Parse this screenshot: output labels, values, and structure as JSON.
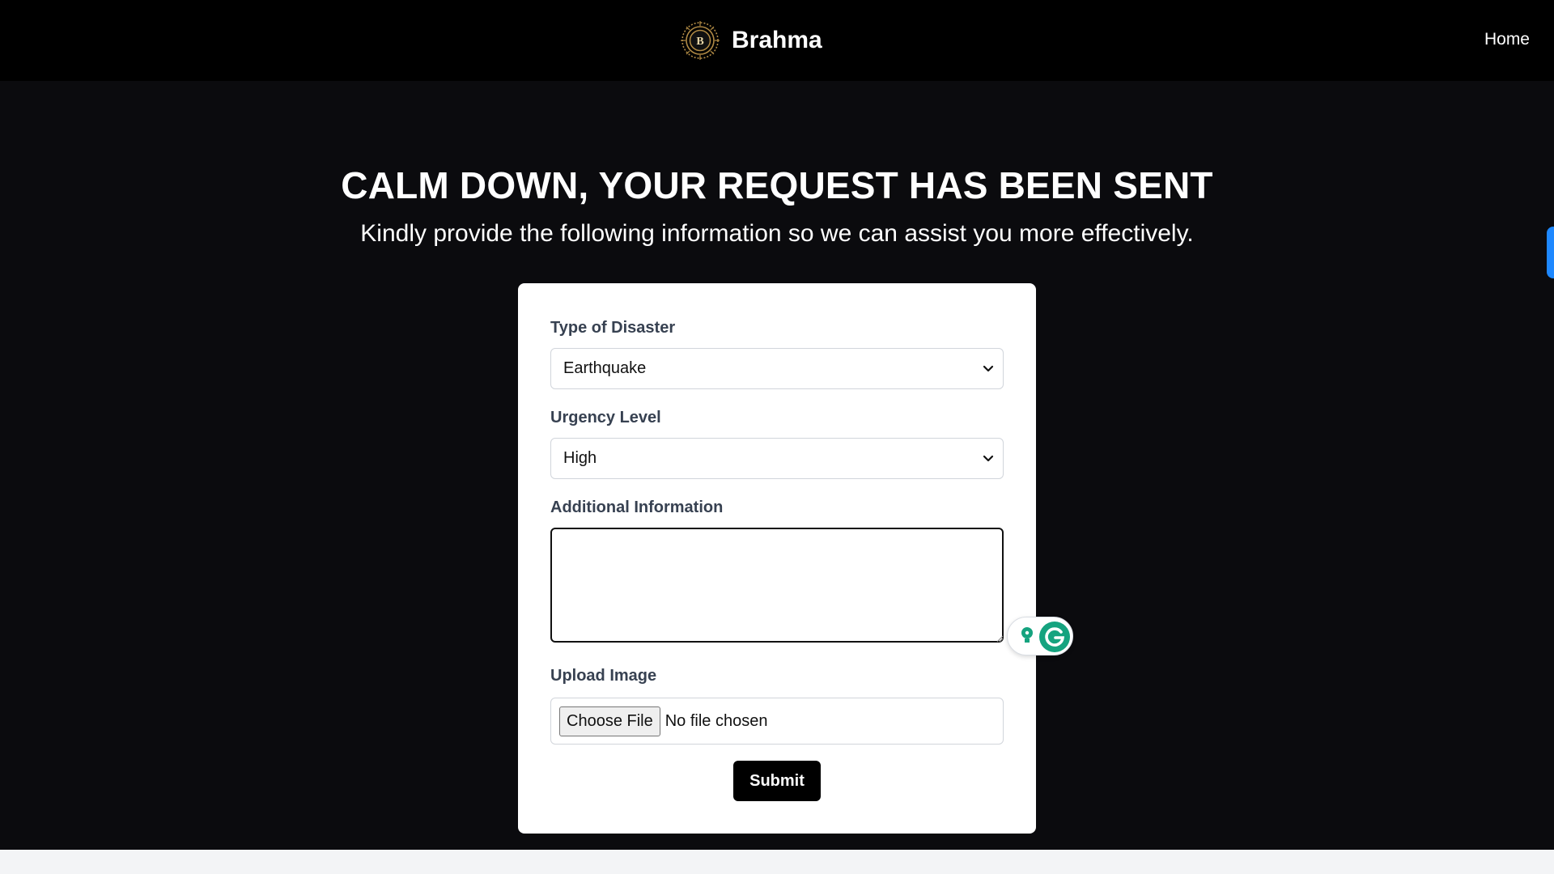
{
  "nav": {
    "brand_name": "Brahma",
    "logo_letter": "B",
    "home_link": "Home"
  },
  "hero": {
    "title": "CALM DOWN, YOUR REQUEST HAS BEEN SENT",
    "subtitle": "Kindly provide the following information so we can assist you more effectively."
  },
  "form": {
    "disaster_label": "Type of Disaster",
    "disaster_value": "Earthquake",
    "urgency_label": "Urgency Level",
    "urgency_value": "High",
    "info_label": "Additional Information",
    "info_value": "",
    "upload_label": "Upload Image",
    "file_button": "Choose File",
    "file_status": "No file chosen",
    "submit_label": "Submit"
  },
  "colors": {
    "navbar": "#000000",
    "hero_background": "#0b0b0e",
    "card": "#ffffff",
    "accent_gold": "#b08a45",
    "grammarly_green": "#15a37f",
    "side_tab": "#1e88ff"
  },
  "icons": {
    "brand": "ornate-b-logo-icon",
    "select_arrow": "chevron-down-icon",
    "grammarly": "grammarly-icon",
    "suggestion": "lightbulb-icon",
    "resize": "resize-handle-icon"
  }
}
